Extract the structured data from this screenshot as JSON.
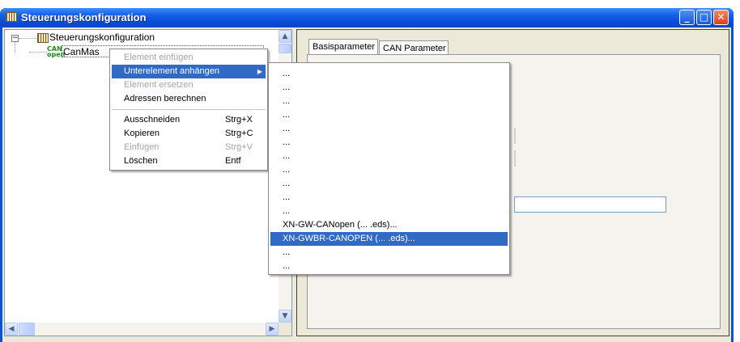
{
  "window": {
    "title": "Steuerungskonfiguration",
    "buttons": {
      "minimize": "_",
      "maximize": "□",
      "close": "✕"
    }
  },
  "tree": {
    "root_label": "Steuerungskonfiguration",
    "child_label": "CanMas",
    "child_label_tail": "",
    "expander": "−"
  },
  "scrollbar": {
    "up": "▲",
    "down": "▼",
    "left": "◀",
    "right": "▶"
  },
  "tabs": [
    {
      "label": "Basisparameter",
      "active": true
    },
    {
      "label": "CAN Parameter",
      "active": false
    }
  ],
  "context_menu": {
    "items": [
      {
        "label": "Element einfügen",
        "shortcut": "",
        "disabled": true,
        "highlighted": false,
        "submenu": false
      },
      {
        "label": "Unterelement anhängen",
        "shortcut": "",
        "disabled": false,
        "highlighted": true,
        "submenu": true
      },
      {
        "label": "Element ersetzen",
        "shortcut": "",
        "disabled": true,
        "highlighted": false,
        "submenu": false
      },
      {
        "label": "Adressen berechnen",
        "shortcut": "",
        "disabled": false,
        "highlighted": false,
        "submenu": false
      },
      {
        "label": "Ausschneiden",
        "shortcut": "Strg+X",
        "disabled": false,
        "highlighted": false,
        "submenu": false
      },
      {
        "label": "Kopieren",
        "shortcut": "Strg+C",
        "disabled": false,
        "highlighted": false,
        "submenu": false
      },
      {
        "label": "Einfügen",
        "shortcut": "Strg+V",
        "disabled": true,
        "highlighted": false,
        "submenu": false
      },
      {
        "label": "Löschen",
        "shortcut": "Entf",
        "disabled": false,
        "highlighted": false,
        "submenu": false
      }
    ],
    "submenu_arrow": "▶"
  },
  "submenu": {
    "items": [
      "...",
      "...",
      "...",
      "...",
      "...",
      "...",
      "...",
      "...",
      "...",
      "...",
      "...",
      "XN-GW-CANopen (... .eds)...",
      "XN-GWBR-CANOPEN (... .eds)...",
      "...",
      "..."
    ],
    "highlighted_index": 12
  },
  "colors": {
    "titlebar": "#0a52d8",
    "highlight": "#316ac5",
    "window_bg": "#ece9d8"
  },
  "icons": {
    "app": "controller-config-icon",
    "can": "can-open-icon"
  }
}
